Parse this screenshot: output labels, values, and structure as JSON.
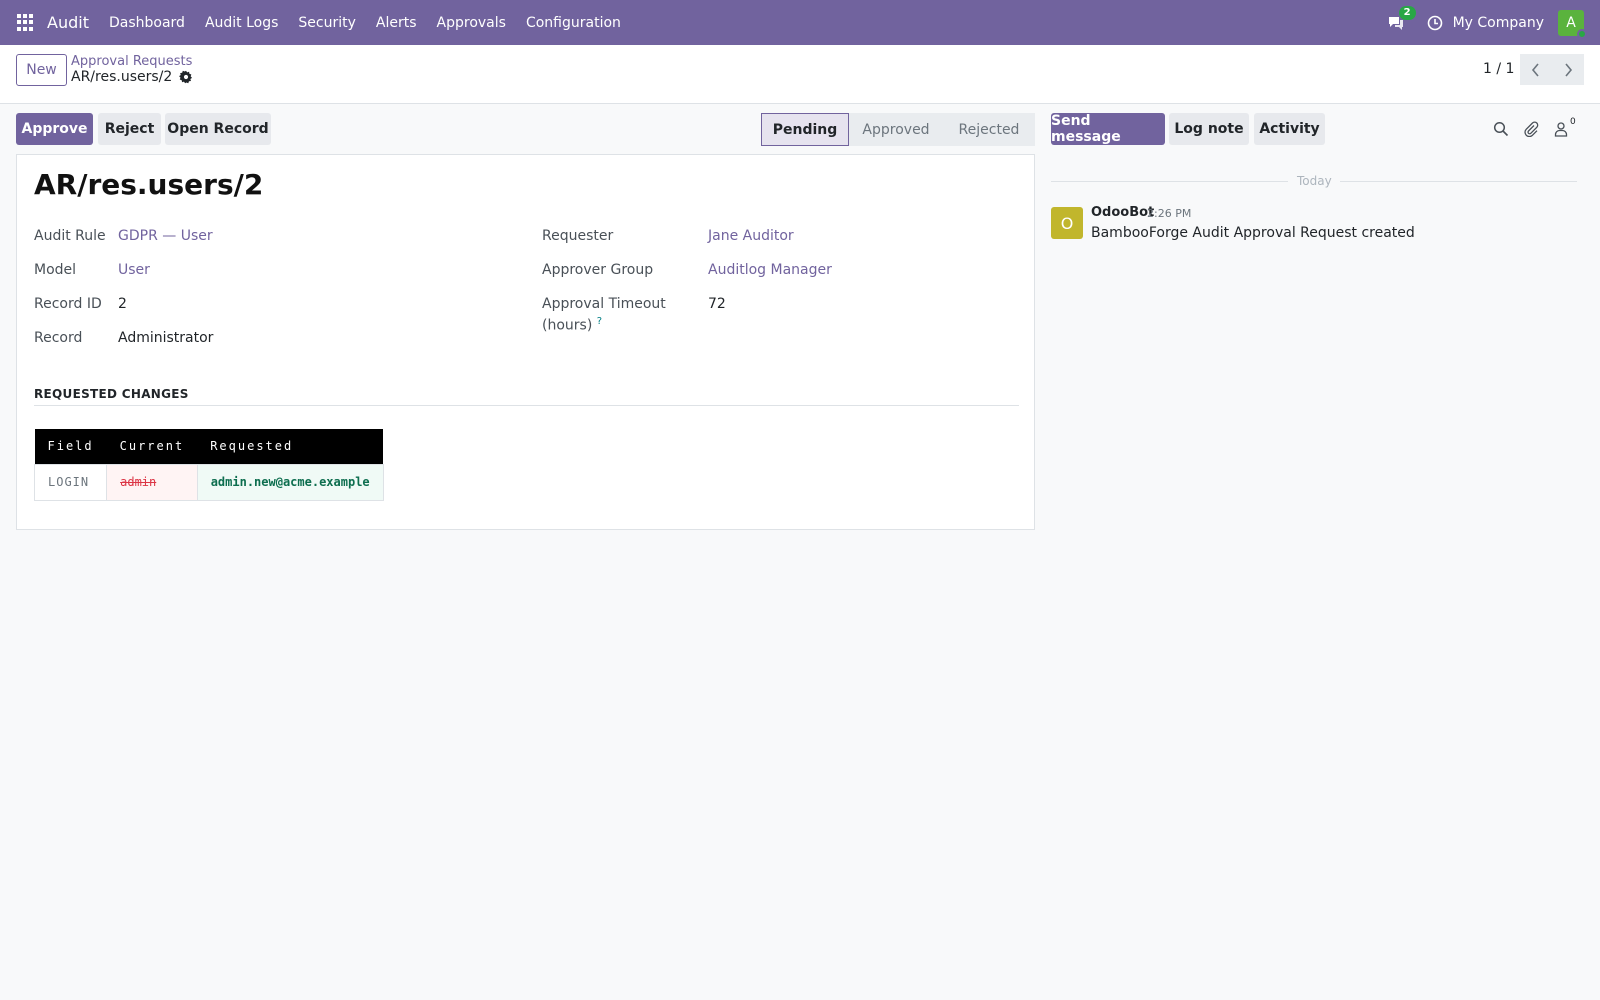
{
  "navbar": {
    "app_name": "Audit",
    "menu": [
      "Dashboard",
      "Audit Logs",
      "Security",
      "Alerts",
      "Approvals",
      "Configuration"
    ],
    "message_count": "2",
    "company": "My Company",
    "avatar_letter": "A",
    "avatar_color": "#5ab33d",
    "accent_color": "#71639e"
  },
  "control": {
    "new_label": "New",
    "breadcrumb_parent": "Approval Requests",
    "breadcrumb_current": "AR/res.users/2",
    "pager": "1 / 1"
  },
  "actions": {
    "approve": "Approve",
    "reject": "Reject",
    "open_record": "Open Record"
  },
  "statusbar": {
    "stages": [
      "Pending",
      "Approved",
      "Rejected"
    ],
    "active": "Pending"
  },
  "form": {
    "title": "AR/res.users/2",
    "fields": {
      "audit_rule_label": "Audit Rule",
      "audit_rule_value": "GDPR — User",
      "model_label": "Model",
      "model_value": "User",
      "record_id_label": "Record ID",
      "record_id_value": "2",
      "record_label": "Record",
      "record_value": "Administrator",
      "requester_label": "Requester",
      "requester_value": "Jane Auditor",
      "approver_group_label": "Approver Group",
      "approver_group_value": "Auditlog Manager",
      "timeout_label_1": "Approval Timeout",
      "timeout_label_2": "(hours)",
      "timeout_help": "?",
      "timeout_value": "72"
    },
    "section_title": "REQUESTED CHANGES",
    "changes": {
      "headers": [
        "Field",
        "Current",
        "Requested"
      ],
      "rows": [
        {
          "field": "LOGIN",
          "current": "admin",
          "requested": "admin.new@acme.example"
        }
      ]
    }
  },
  "chatter": {
    "send_message": "Send message",
    "log_note": "Log note",
    "activity": "Activity",
    "follower_count": "0",
    "date_separator": "Today",
    "message": {
      "avatar_letter": "O",
      "author": "OdooBot",
      "time": "2:26 PM",
      "body": "BambooForge Audit Approval Request created"
    }
  }
}
